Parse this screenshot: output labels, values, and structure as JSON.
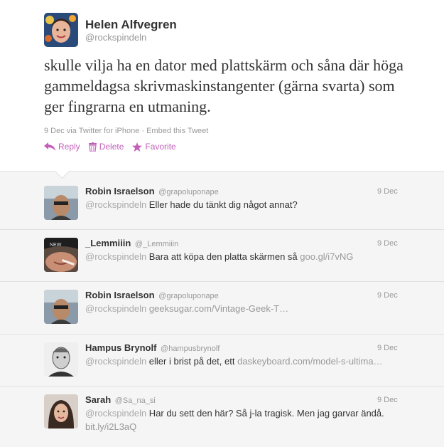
{
  "tweet": {
    "author_name": "Helen Alfvegren",
    "author_handle": "@rockspindeln",
    "text": "skulle vilja ha en dator med plattskärm och såna där höga gammeldagsa skrivmaskinstangenter (gärna svarta) som ger fingrarna en utmaning.",
    "meta_date": "9 Dec via Twitter for iPhone",
    "meta_separator": " · ",
    "meta_embed": "Embed this Tweet",
    "actions": {
      "reply": "Reply",
      "delete": "Delete",
      "favorite": "Favorite"
    },
    "accent_color": "#c260b9"
  },
  "replies": [
    {
      "name": "Robin Israelson",
      "handle": "@grapoluponape",
      "date": "9 Dec",
      "mention": "@rockspindeln",
      "text": " Eller hade du tänkt dig något annat?",
      "link": ""
    },
    {
      "name": "_Lemmiiin",
      "handle": "@_Lemmiiin",
      "date": "9 Dec",
      "mention": "@rockspindeln",
      "text": " Bara att köpa den platta skärmen så ",
      "link": "goo.gl/i7vNG"
    },
    {
      "name": "Robin Israelson",
      "handle": "@grapoluponape",
      "date": "9 Dec",
      "mention": "@rockspindeln",
      "text": " ",
      "link": "geeksugar.com/Vintage-Geek-T…"
    },
    {
      "name": "Hampus Brynolf",
      "handle": "@hampusbrynolf",
      "date": "9 Dec",
      "mention": "@rockspindeln",
      "text": " eller i brist på det, ett ",
      "link": "daskeyboard.com/model-s-ultima…"
    },
    {
      "name": "Sarah",
      "handle": "@Sa_na_si",
      "date": "9 Dec",
      "mention": "@rockspindeln",
      "text": " Har du sett den här? Så j-la tragisk. Men jag garvar ändå. ",
      "link": "bit.ly/i2L3aQ"
    }
  ]
}
